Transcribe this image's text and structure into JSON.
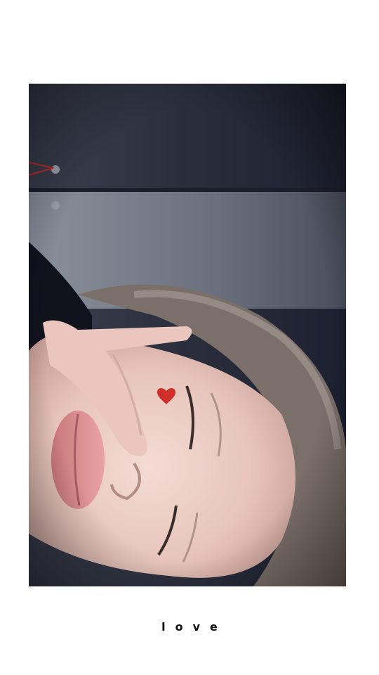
{
  "caption": "love",
  "colors": {
    "background": "#ffffff",
    "heart": "#d0302a",
    "wall_dark": "#1f2232",
    "wall_light": "#8a8f9c",
    "skin": "#e8c9c0",
    "lips": "#d98a8c"
  },
  "photo": {
    "subject": "selfie",
    "sticker": "heart-icon"
  }
}
